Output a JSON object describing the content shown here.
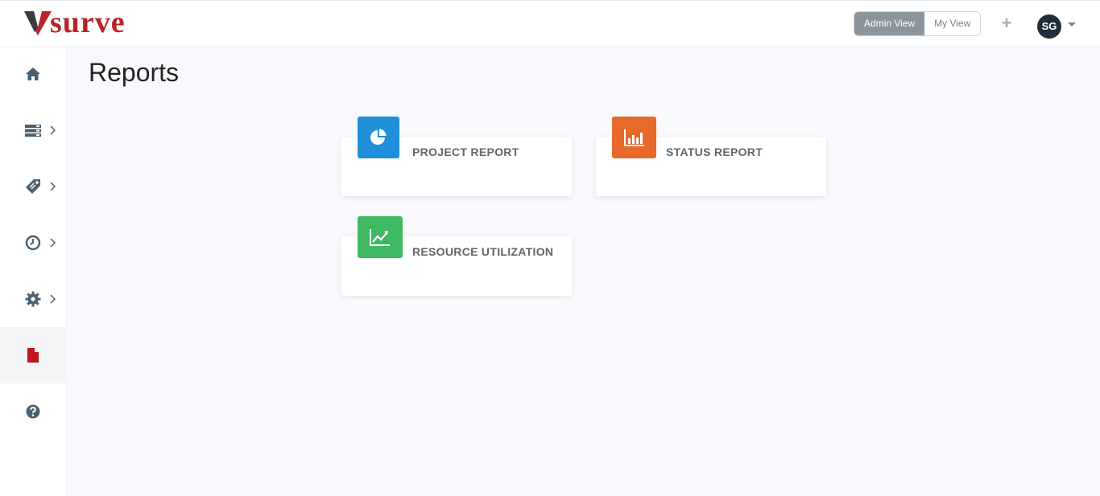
{
  "header": {
    "logo_text": "surve",
    "admin_view_label": "Admin View",
    "my_view_label": "My View",
    "plus_label": "+",
    "avatar_initials": "SG"
  },
  "sidebar": {
    "items": [
      {
        "icon": "home-icon",
        "has_children": false,
        "active": false
      },
      {
        "icon": "list-icon",
        "has_children": true,
        "active": false
      },
      {
        "icon": "tag-icon",
        "has_children": true,
        "active": false
      },
      {
        "icon": "clock-icon",
        "has_children": true,
        "active": false
      },
      {
        "icon": "gear-icon",
        "has_children": true,
        "active": false
      },
      {
        "icon": "file-icon",
        "has_children": false,
        "active": true
      },
      {
        "icon": "help-icon",
        "has_children": false,
        "active": false
      }
    ]
  },
  "main": {
    "title": "Reports",
    "cards": [
      {
        "label": "PROJECT REPORT",
        "icon": "pie-chart-icon",
        "color": "#1e8fd8"
      },
      {
        "label": "STATUS REPORT",
        "icon": "bar-chart-icon",
        "color": "#e8692c"
      },
      {
        "label": "RESOURCE UTILIZATION",
        "icon": "line-chart-icon",
        "color": "#3fb962"
      }
    ]
  },
  "colors": {
    "brand_red": "#b8242b",
    "sidebar_icon": "#4a6070",
    "active_icon": "#c0161d"
  }
}
